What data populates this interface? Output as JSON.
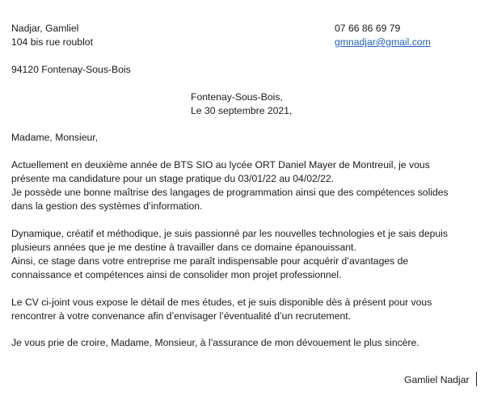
{
  "sender": {
    "name": "Nadjar, Gamliel",
    "street": "104 bis rue roublot",
    "city": "94120 Fontenay-Sous-Bois",
    "phone": "07 66 86 69 79",
    "email": "gmnadjar@gmail.com"
  },
  "place_date": {
    "place": "Fontenay-Sous-Bois,",
    "date": "Le 30 septembre 2021,"
  },
  "salutation": "Madame, Monsieur,",
  "paragraphs": [
    {
      "lines": [
        "Actuellement en deuxième année de BTS SIO au lycée ORT Daniel Mayer de Montreuil, je vous",
        "présente ma candidature pour un stage pratique du 03/01/22 au 04/02/22.",
        "Je possède une bonne maîtrise des langages de programmation ainsi que des compétences solides",
        "dans la gestion des systèmes d’information."
      ]
    },
    {
      "lines": [
        "Dynamique, créatif et méthodique, je suis passionné par les nouvelles technologies et je sais depuis",
        "plusieurs années que je me destine à travailler dans ce domaine épanouissant.",
        "Ainsi, ce stage dans votre entreprise me paraît indispensable pour acquérir d’avantages de",
        "connaissance et compétences ainsi de consolider mon projet professionnel."
      ]
    },
    {
      "lines": [
        "Le CV ci-joint vous expose le détail de mes études, et je suis disponible dès à présent pour vous",
        "rencontrer à votre convenance afin d’envisager l’éventualité d’un recrutement."
      ]
    },
    {
      "lines": [
        "Je vous prie de croire, Madame, Monsieur, à l’assurance de mon dévouement le plus sincère."
      ]
    }
  ],
  "signature": "Gamliel Nadjar"
}
